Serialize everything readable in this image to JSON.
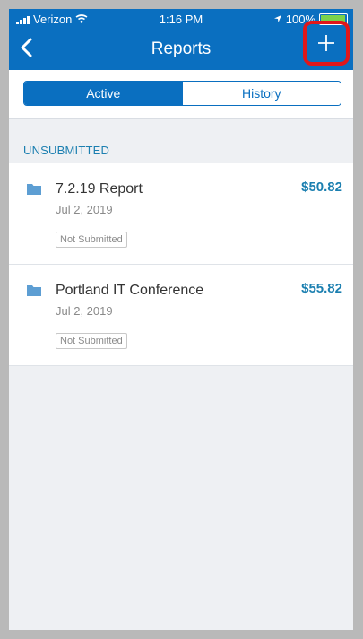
{
  "status": {
    "carrier": "Verizon",
    "time": "1:16 PM",
    "battery": "100%"
  },
  "nav": {
    "title": "Reports"
  },
  "tabs": [
    {
      "label": "Active",
      "selected": true
    },
    {
      "label": "History",
      "selected": false
    }
  ],
  "section": {
    "label": "UNSUBMITTED"
  },
  "reports": [
    {
      "title": "7.2.19 Report",
      "date": "Jul 2, 2019",
      "status": "Not Submitted",
      "amount": "$50.82"
    },
    {
      "title": "Portland IT Conference",
      "date": "Jul 2, 2019",
      "status": "Not Submitted",
      "amount": "$55.82"
    }
  ],
  "colors": {
    "primary": "#0a6fc0",
    "highlight": "#e0171b",
    "amount": "#1b7fb0"
  }
}
